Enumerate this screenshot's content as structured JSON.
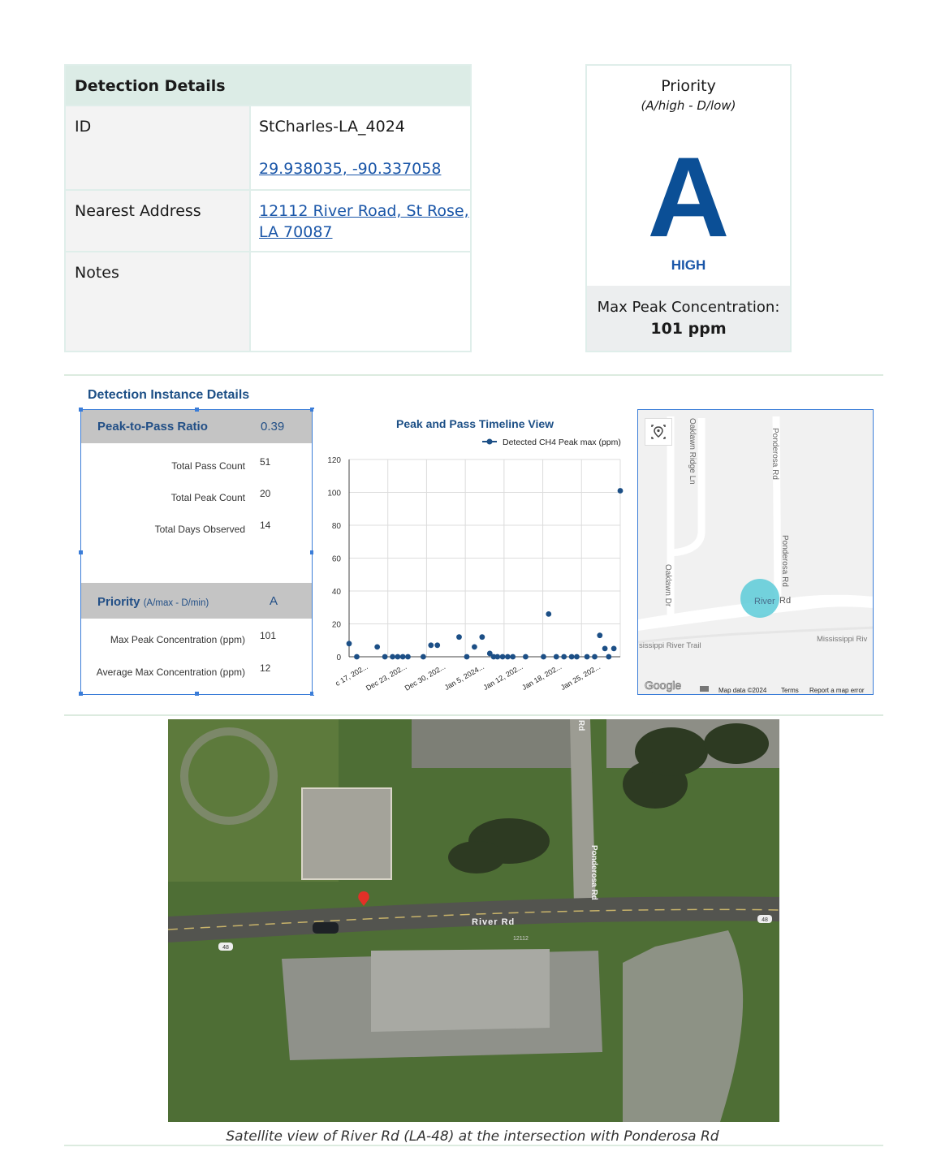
{
  "detection_details": {
    "header": "Detection Details",
    "id_label": "ID",
    "id_value": "StCharles-LA_4024",
    "coords": "29.938035, -90.337058",
    "address_label": "Nearest Address",
    "address_line1": "12112 River Road, St Rose,",
    "address_line2": "LA 70087",
    "notes_label": "Notes",
    "notes_value": ""
  },
  "priority_box": {
    "title": "Priority",
    "subtitle": "(A/high - D/low)",
    "letter": "A",
    "level": "HIGH",
    "max_peak_label": "Max Peak Concentration:",
    "max_peak_value": "101 ppm",
    "accent_color": "#0b4f96"
  },
  "instance": {
    "title": "Detection Instance Details",
    "ratio_label": "Peak-to-Pass Ratio",
    "ratio_value": "0.39",
    "stats": [
      {
        "label": "Total Pass Count",
        "value": "51"
      },
      {
        "label": "Total Peak Count",
        "value": "20"
      },
      {
        "label": "Total Days Observed",
        "value": "14"
      }
    ],
    "priority_label": "Priority",
    "priority_sub": "(A/max - D/min)",
    "priority_value": "A",
    "conc": [
      {
        "label": "Max Peak Concentration (ppm)",
        "value": "101"
      },
      {
        "label": "Average Max Concentration (ppm)",
        "value": "12"
      }
    ]
  },
  "chart_data": {
    "type": "scatter",
    "title": "Peak and Pass Timeline View",
    "xlabel": "",
    "ylabel": "",
    "ylim": [
      0,
      120
    ],
    "yticks": [
      0,
      20,
      40,
      60,
      80,
      100,
      120
    ],
    "xtick_labels": [
      "c 17, 202...",
      "Dec 23, 202...",
      "Dec 30, 202...",
      "Jan 5, 2024...",
      "Jan 12, 202...",
      "Jan 18, 202...",
      "Jan 25, 202..."
    ],
    "legend": "top-right",
    "grid": true,
    "series": [
      {
        "name": "Detected CH4 Peak max (ppm)",
        "color": "#1c4f86",
        "x": [
          0,
          0.3,
          1.1,
          1.4,
          1.7,
          1.9,
          2.1,
          2.3,
          2.9,
          3.2,
          3.45,
          4.3,
          4.6,
          4.9,
          5.2,
          5.5,
          5.65,
          5.8,
          6.0,
          6.2,
          6.4,
          6.9,
          7.6,
          7.8,
          8.1,
          8.4,
          8.7,
          8.9,
          9.3,
          9.6,
          9.8,
          10.0,
          10.15,
          10.35,
          10.6
        ],
        "values": [
          8,
          0,
          6,
          0,
          0,
          0,
          0,
          0,
          0,
          7,
          7,
          12,
          0,
          6,
          12,
          2,
          0,
          0,
          0,
          0,
          0,
          0,
          0,
          26,
          0,
          0,
          0,
          0,
          0,
          0,
          13,
          5,
          0,
          5,
          101
        ]
      }
    ]
  },
  "map": {
    "street_oaklawn_ridge": "Oaklawn Ridge Ln",
    "street_ponderosa_top": "Ponderosa Rd",
    "street_ponderosa_mid": "Ponderosa Rd",
    "street_oaklawn_dr": "Oaklawn Dr",
    "street_river_a": "River",
    "street_river_b": "Rd",
    "trail": "sissippi River Trail",
    "river": "Mississippi Riv",
    "google": "Google",
    "map_data": "Map data ©2024",
    "terms": "Terms",
    "report": "Report a map error",
    "location_icon": "location-pin-icon"
  },
  "satellite": {
    "river_rd": "River Rd",
    "ponderosa_rd": "Ponderosa Rd",
    "rd_top": "Rd",
    "shield_left": "48",
    "shield_right": "48",
    "addr_num": "12112"
  },
  "caption": "Satellite view of River Rd (LA-48) at  the intersection with Ponderosa Rd"
}
